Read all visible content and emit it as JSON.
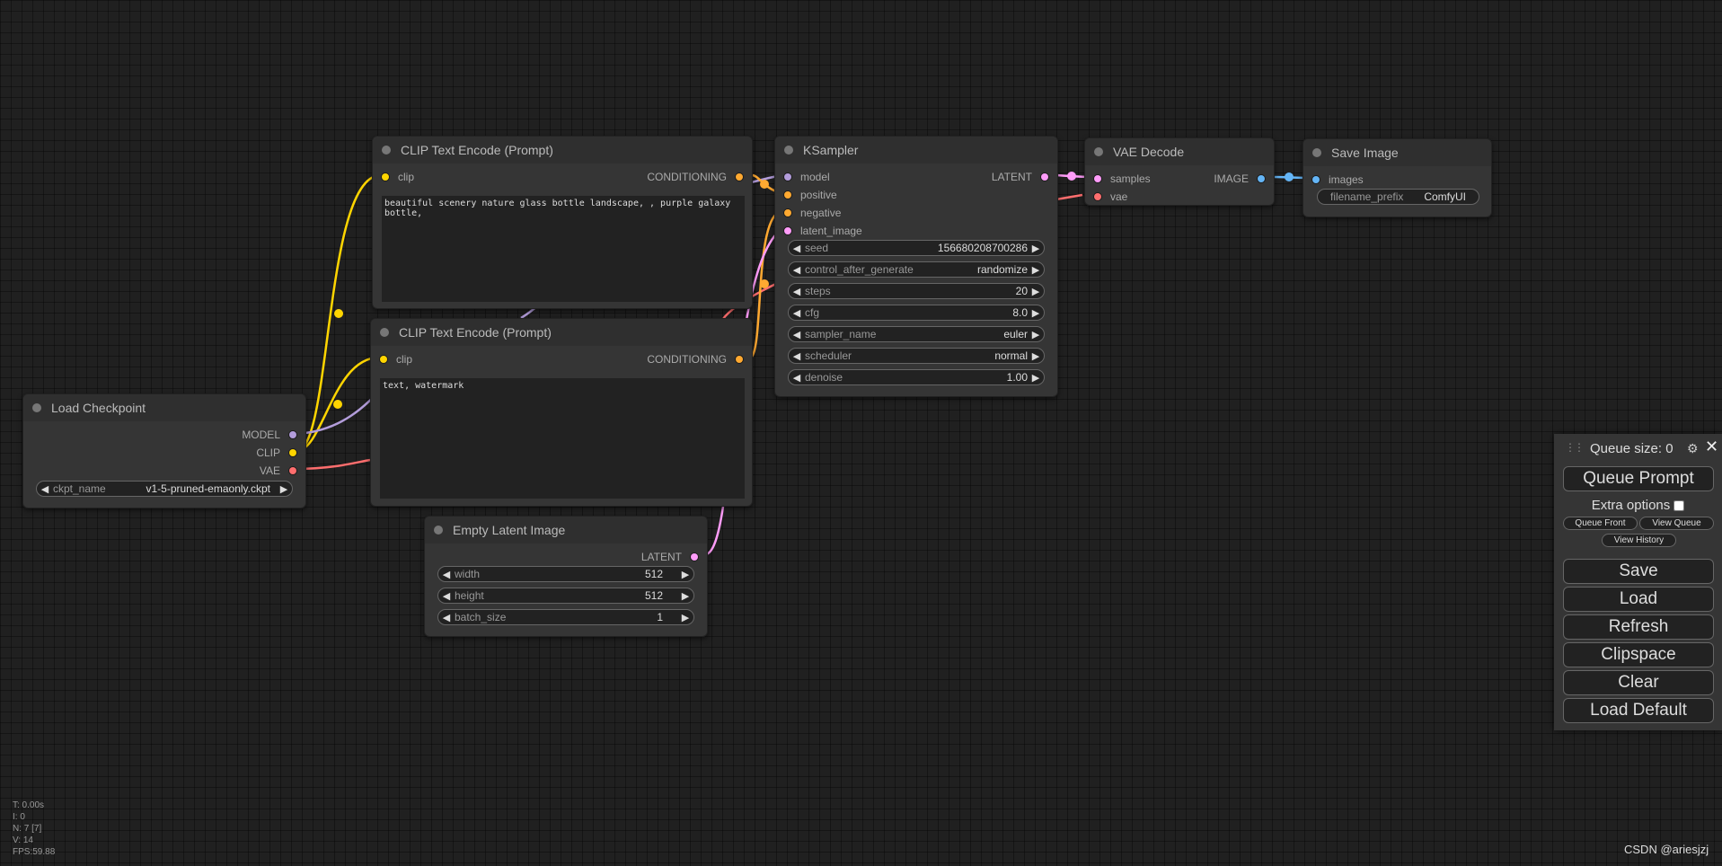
{
  "nodes": {
    "clip_pos": {
      "title": "CLIP Text Encode (Prompt)",
      "input": "clip",
      "output": "CONDITIONING",
      "text": "beautiful scenery nature glass bottle landscape, , purple galaxy bottle,"
    },
    "clip_neg": {
      "title": "CLIP Text Encode (Prompt)",
      "input": "clip",
      "output": "CONDITIONING",
      "text": "text, watermark"
    },
    "ksampler": {
      "title": "KSampler",
      "inputs": [
        "model",
        "positive",
        "negative",
        "latent_image"
      ],
      "output": "LATENT",
      "widgets": [
        {
          "label": "seed",
          "value": "156680208700286"
        },
        {
          "label": "control_after_generate",
          "value": "randomize"
        },
        {
          "label": "steps",
          "value": "20"
        },
        {
          "label": "cfg",
          "value": "8.0"
        },
        {
          "label": "sampler_name",
          "value": "euler"
        },
        {
          "label": "scheduler",
          "value": "normal"
        },
        {
          "label": "denoise",
          "value": "1.00"
        }
      ]
    },
    "vae_decode": {
      "title": "VAE Decode",
      "inputs": [
        "samples",
        "vae"
      ],
      "output": "IMAGE"
    },
    "save_image": {
      "title": "Save Image",
      "input": "images",
      "widget": {
        "label": "filename_prefix",
        "value": "ComfyUI"
      }
    },
    "load_checkpoint": {
      "title": "Load Checkpoint",
      "outputs": [
        "MODEL",
        "CLIP",
        "VAE"
      ],
      "widget": {
        "label": "ckpt_name",
        "value": "v1-5-pruned-emaonly.ckpt"
      }
    },
    "empty_latent": {
      "title": "Empty Latent Image",
      "output": "LATENT",
      "widgets": [
        {
          "label": "width",
          "value": "512"
        },
        {
          "label": "height",
          "value": "512"
        },
        {
          "label": "batch_size",
          "value": "1"
        }
      ]
    }
  },
  "menu": {
    "queue_size": "Queue size: 0",
    "queue_prompt": "Queue Prompt",
    "extra_options": "Extra options",
    "queue_front": "Queue Front",
    "view_queue": "View Queue",
    "view_history": "View History",
    "save": "Save",
    "load": "Load",
    "refresh": "Refresh",
    "clipspace": "Clipspace",
    "clear": "Clear",
    "load_default": "Load Default"
  },
  "stats": [
    "T: 0.00s",
    "I: 0",
    "N: 7 [7]",
    "V: 14",
    "FPS:59.88"
  ],
  "watermark": "CSDN @ariesjzj",
  "colors": {
    "clip": "#ffd500",
    "conditioning": "#ffa931",
    "model": "#b39ddb",
    "latent": "#ff9cf9",
    "vae": "#ff6e6e",
    "image": "#64b5f6"
  }
}
